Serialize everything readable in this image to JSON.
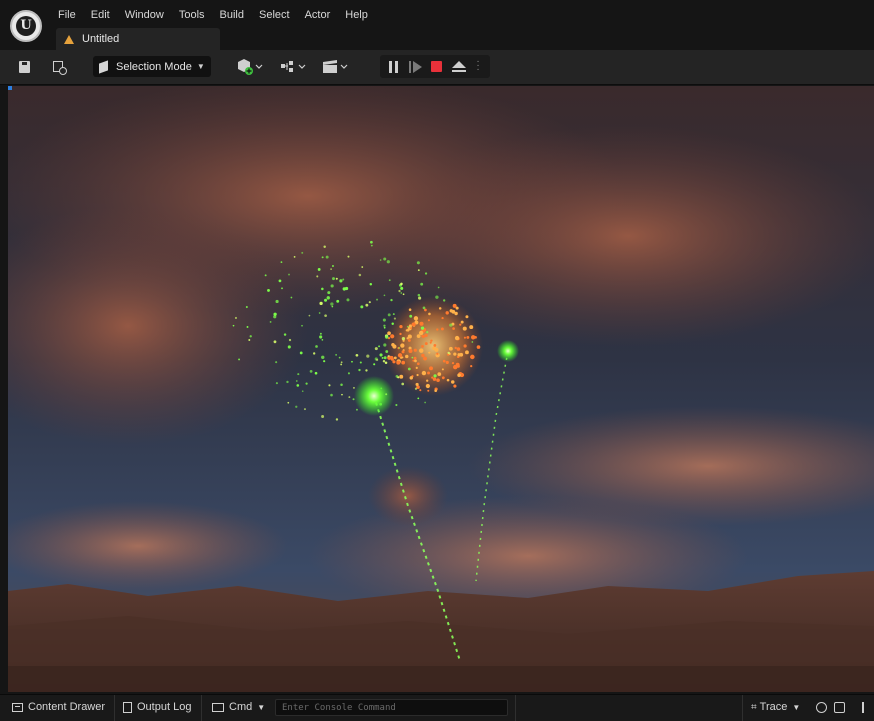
{
  "app": {
    "logo_letter": "U"
  },
  "menu": [
    "File",
    "Edit",
    "Window",
    "Tools",
    "Build",
    "Select",
    "Actor",
    "Help"
  ],
  "document_tab": {
    "title": "Untitled"
  },
  "toolbar": {
    "mode_label": "Selection Mode"
  },
  "status_bar": {
    "content_drawer": "Content Drawer",
    "output_log": "Output Log",
    "cmd": "Cmd",
    "console_placeholder": "Enter Console Command",
    "trace": "Trace"
  },
  "colors": {
    "accent_stop": "#e8313a",
    "warning": "#e6a23c",
    "firework_green": "#5cff3a",
    "firework_orange": "#ff9a3a"
  }
}
